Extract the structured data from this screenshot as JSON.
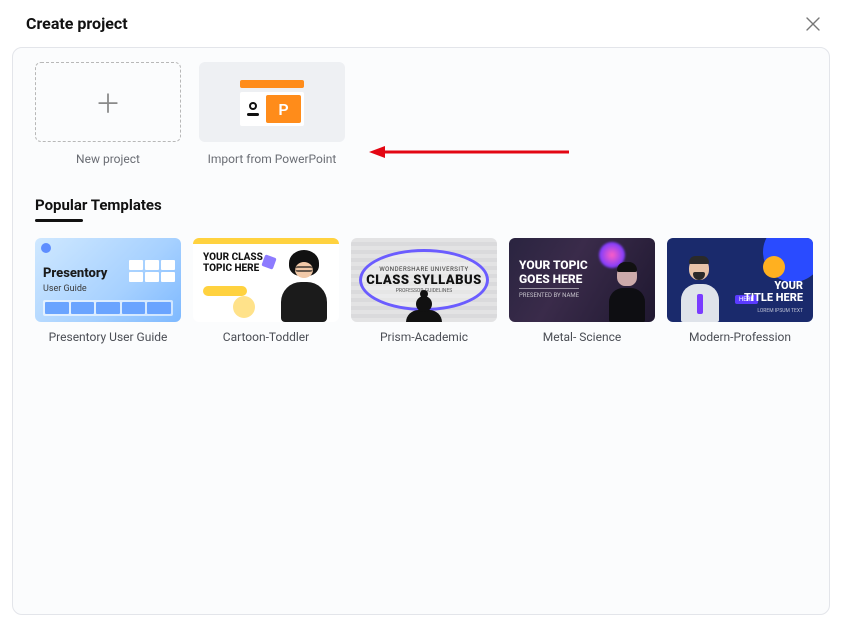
{
  "header": {
    "title": "Create project"
  },
  "actions": {
    "new_project_label": "New project",
    "import_label": "Import from PowerPoint",
    "import_badge": "P"
  },
  "section": {
    "popular_title": "Popular Templates"
  },
  "templates": [
    {
      "label": "Presentory User Guide",
      "thumb_title": "Presentory",
      "thumb_sub": "User Guide"
    },
    {
      "label": "Cartoon-Toddler",
      "thumb_line1": "YOUR CLASS",
      "thumb_line2": "TOPIC HERE"
    },
    {
      "label": "Prism-Academic",
      "thumb_small": "WONDERSHARE UNIVERSITY",
      "thumb_big": "CLASS SYLLABUS",
      "thumb_sub": "PROFESSOR GUIDELINES"
    },
    {
      "label": "Metal- Science",
      "thumb_line1": "YOUR TOPIC",
      "thumb_line2": "GOES HERE",
      "thumb_sub": "PRESENTED BY NAME"
    },
    {
      "label": "Modern-Profession",
      "thumb_tag": "HERE",
      "thumb_line1": "YOUR",
      "thumb_line2": "TITLE HERE",
      "thumb_sub": "LOREM IPSUM TEXT"
    }
  ]
}
